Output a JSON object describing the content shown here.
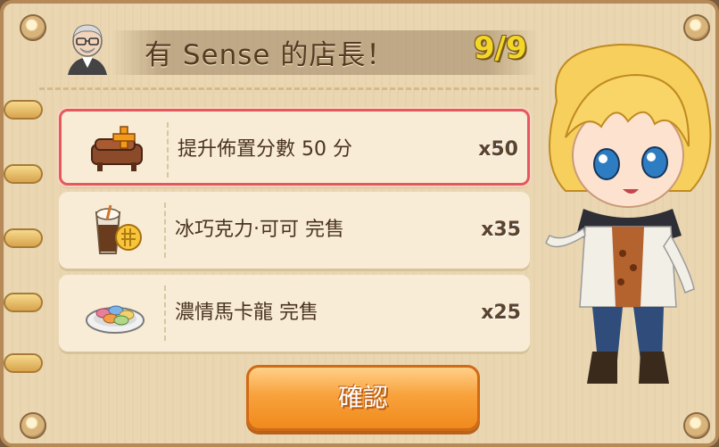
{
  "header": {
    "title": "有 Sense 的店長！",
    "counter": "9/9"
  },
  "rewards": [
    {
      "label": "提升佈置分數 50 分",
      "qty": "x50",
      "icon": "furniture-plus-icon",
      "selected": true
    },
    {
      "label": "冰巧克力‧可可 完售",
      "qty": "x35",
      "icon": "iced-chocolate-icon",
      "selected": false
    },
    {
      "label": "濃情馬卡龍 完售",
      "qty": "x25",
      "icon": "macaron-plate-icon",
      "selected": false
    }
  ],
  "confirm_label": "確認",
  "colors": {
    "board": "#ead7b2",
    "accent": "#f3d728",
    "button": "#f08a1c",
    "selected_border": "#e45a5a"
  }
}
